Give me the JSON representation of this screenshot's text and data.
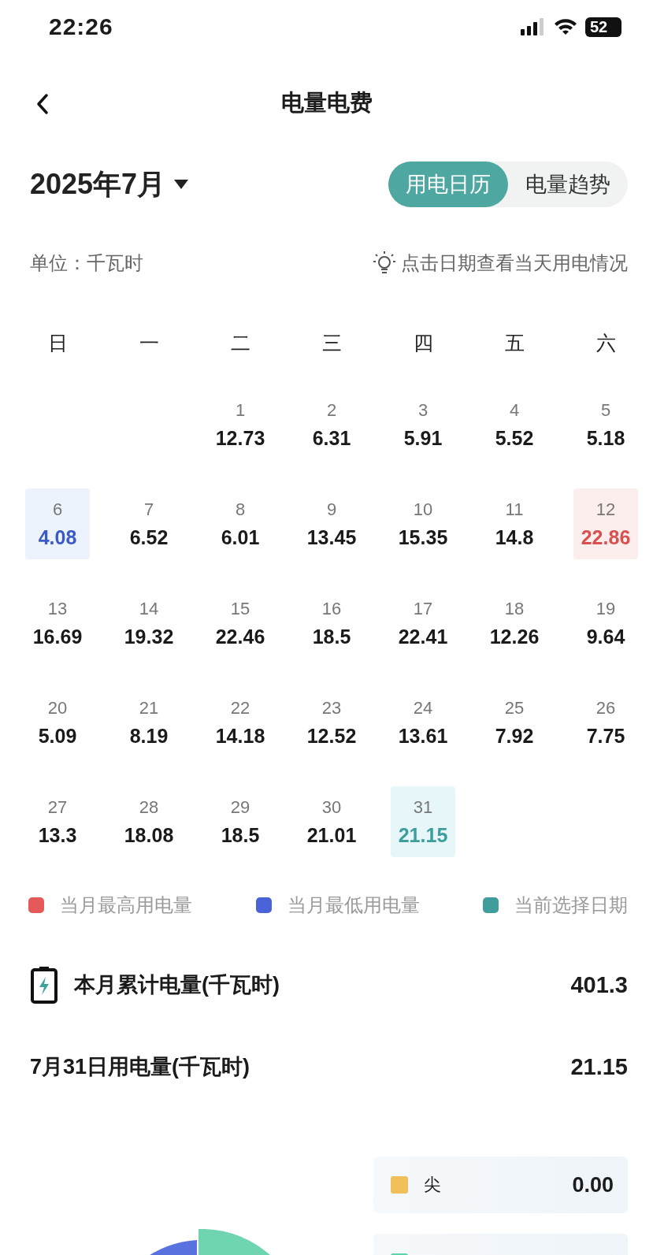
{
  "status_bar": {
    "time": "22:26",
    "battery": "52"
  },
  "nav": {
    "title": "电量电费"
  },
  "header": {
    "month": "2025年7月",
    "tabs": [
      {
        "label": "用电日历",
        "selected": true
      },
      {
        "label": "电量趋势",
        "selected": false
      }
    ]
  },
  "hint_row": {
    "unit": "单位：千瓦时",
    "hint": "点击日期查看当天用电情况"
  },
  "calendar": {
    "weekdays": [
      "日",
      "一",
      "二",
      "三",
      "四",
      "五",
      "六"
    ],
    "weeks": [
      [
        {
          "kind": "blank"
        },
        {
          "kind": "blank"
        },
        {
          "kind": "day",
          "day": "1",
          "value": "12.73",
          "selected": false,
          "month_max": false,
          "month_min": false
        },
        {
          "kind": "day",
          "day": "2",
          "value": "6.31",
          "selected": false,
          "month_max": false,
          "month_min": false
        },
        {
          "kind": "day",
          "day": "3",
          "value": "5.91",
          "selected": false,
          "month_max": false,
          "month_min": false
        },
        {
          "kind": "day",
          "day": "4",
          "value": "5.52",
          "selected": false,
          "month_max": false,
          "month_min": false
        },
        {
          "kind": "day",
          "day": "5",
          "value": "5.18",
          "selected": false,
          "month_max": false,
          "month_min": false
        }
      ],
      [
        {
          "kind": "day",
          "day": "6",
          "value": "4.08",
          "selected": false,
          "month_max": false,
          "month_min": true
        },
        {
          "kind": "day",
          "day": "7",
          "value": "6.52",
          "selected": false,
          "month_max": false,
          "month_min": false
        },
        {
          "kind": "day",
          "day": "8",
          "value": "6.01",
          "selected": false,
          "month_max": false,
          "month_min": false
        },
        {
          "kind": "day",
          "day": "9",
          "value": "13.45",
          "selected": false,
          "month_max": false,
          "month_min": false
        },
        {
          "kind": "day",
          "day": "10",
          "value": "15.35",
          "selected": false,
          "month_max": false,
          "month_min": false
        },
        {
          "kind": "day",
          "day": "11",
          "value": "14.8",
          "selected": false,
          "month_max": false,
          "month_min": false
        },
        {
          "kind": "day",
          "day": "12",
          "value": "22.86",
          "selected": false,
          "month_max": true,
          "month_min": false
        }
      ],
      [
        {
          "kind": "day",
          "day": "13",
          "value": "16.69",
          "selected": false,
          "month_max": false,
          "month_min": false
        },
        {
          "kind": "day",
          "day": "14",
          "value": "19.32",
          "selected": false,
          "month_max": false,
          "month_min": false
        },
        {
          "kind": "day",
          "day": "15",
          "value": "22.46",
          "selected": false,
          "month_max": false,
          "month_min": false
        },
        {
          "kind": "day",
          "day": "16",
          "value": "18.5",
          "selected": false,
          "month_max": false,
          "month_min": false
        },
        {
          "kind": "day",
          "day": "17",
          "value": "22.41",
          "selected": false,
          "month_max": false,
          "month_min": false
        },
        {
          "kind": "day",
          "day": "18",
          "value": "12.26",
          "selected": false,
          "month_max": false,
          "month_min": false
        },
        {
          "kind": "day",
          "day": "19",
          "value": "9.64",
          "selected": false,
          "month_max": false,
          "month_min": false
        }
      ],
      [
        {
          "kind": "day",
          "day": "20",
          "value": "5.09",
          "selected": false,
          "month_max": false,
          "month_min": false
        },
        {
          "kind": "day",
          "day": "21",
          "value": "8.19",
          "selected": false,
          "month_max": false,
          "month_min": false
        },
        {
          "kind": "day",
          "day": "22",
          "value": "14.18",
          "selected": false,
          "month_max": false,
          "month_min": false
        },
        {
          "kind": "day",
          "day": "23",
          "value": "12.52",
          "selected": false,
          "month_max": false,
          "month_min": false
        },
        {
          "kind": "day",
          "day": "24",
          "value": "13.61",
          "selected": false,
          "month_max": false,
          "month_min": false
        },
        {
          "kind": "day",
          "day": "25",
          "value": "7.92",
          "selected": false,
          "month_max": false,
          "month_min": false
        },
        {
          "kind": "day",
          "day": "26",
          "value": "7.75",
          "selected": false,
          "month_max": false,
          "month_min": false
        }
      ],
      [
        {
          "kind": "day",
          "day": "27",
          "value": "13.3",
          "selected": false,
          "month_max": false,
          "month_min": false
        },
        {
          "kind": "day",
          "day": "28",
          "value": "18.08",
          "selected": false,
          "month_max": false,
          "month_min": false
        },
        {
          "kind": "day",
          "day": "29",
          "value": "18.5",
          "selected": false,
          "month_max": false,
          "month_min": false
        },
        {
          "kind": "day",
          "day": "30",
          "value": "21.01",
          "selected": false,
          "month_max": false,
          "month_min": false
        },
        {
          "kind": "day",
          "day": "31",
          "value": "21.15",
          "selected": true,
          "month_max": false,
          "month_min": false
        }
      ]
    ]
  },
  "legend": [
    {
      "label": "当月最高用电量",
      "color": "#e5595a"
    },
    {
      "label": "当月最低用电量",
      "color": "#4a63d9"
    },
    {
      "label": "当前选择日期",
      "color": "#3f9e9b"
    }
  ],
  "summary": [
    {
      "kind": "month_total",
      "label": "本月累计电量(千瓦时)",
      "value": "401.3"
    },
    {
      "kind": "day_total",
      "label": "7月31日用电量(千瓦时)",
      "value": "21.15"
    }
  ],
  "breakdown": [
    {
      "label": "尖",
      "value": "0.00",
      "color": "#f2c05a"
    },
    {
      "color": "#5fd3a8"
    }
  ]
}
